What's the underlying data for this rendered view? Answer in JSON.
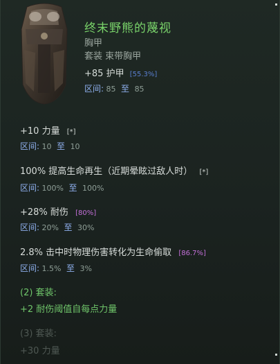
{
  "item": {
    "name": "终末野熊的蔑视",
    "slot": "胸甲",
    "set_type": "套装 束带胸甲",
    "armor": {
      "value": "+85",
      "label": "护甲",
      "roll": "[55.3%]"
    },
    "armor_range": {
      "label": "区间:",
      "min": "85",
      "to": "至",
      "max": "85"
    }
  },
  "affixes": [
    {
      "text": "+10 力量",
      "roll": "[*]",
      "roll_color": "#cfd5d1",
      "range_label": "区间:",
      "min": "10",
      "to": "至",
      "max": "10"
    },
    {
      "text": "100% 提高生命再生（近期晕眩过敌人时）",
      "roll": "[*]",
      "roll_color": "#cfd5d1",
      "range_label": "区间:",
      "min": "100%",
      "to": "至",
      "max": "100%"
    },
    {
      "text": "+28% 耐伤",
      "roll": "[80%]",
      "roll_color": "#c36fd8",
      "range_label": "区间:",
      "min": "20%",
      "to": "至",
      "max": "30%"
    },
    {
      "text": "2.8% 击中时物理伤害转化为生命偷取",
      "roll": "[86.7%]",
      "roll_color": "#c36fd8",
      "range_label": "区间:",
      "min": "1.5%",
      "to": "至",
      "max": "3%"
    }
  ],
  "set_bonuses": [
    {
      "header": "(2) 套装:",
      "effect": "+2 耐伤阈值自每点力量",
      "active": true
    },
    {
      "header": "(3) 套装:",
      "effect": "+30 力量",
      "active": false
    }
  ],
  "colors": {
    "name": "#79d36a",
    "set_active": "#6fc56a",
    "set_inactive": "#4f5853",
    "range_label": "#8fb0ee",
    "roll_purple": "#c36fd8",
    "armor_roll": "#5a7fd0"
  },
  "icons": {
    "item_art": "chest-armor-icon"
  }
}
